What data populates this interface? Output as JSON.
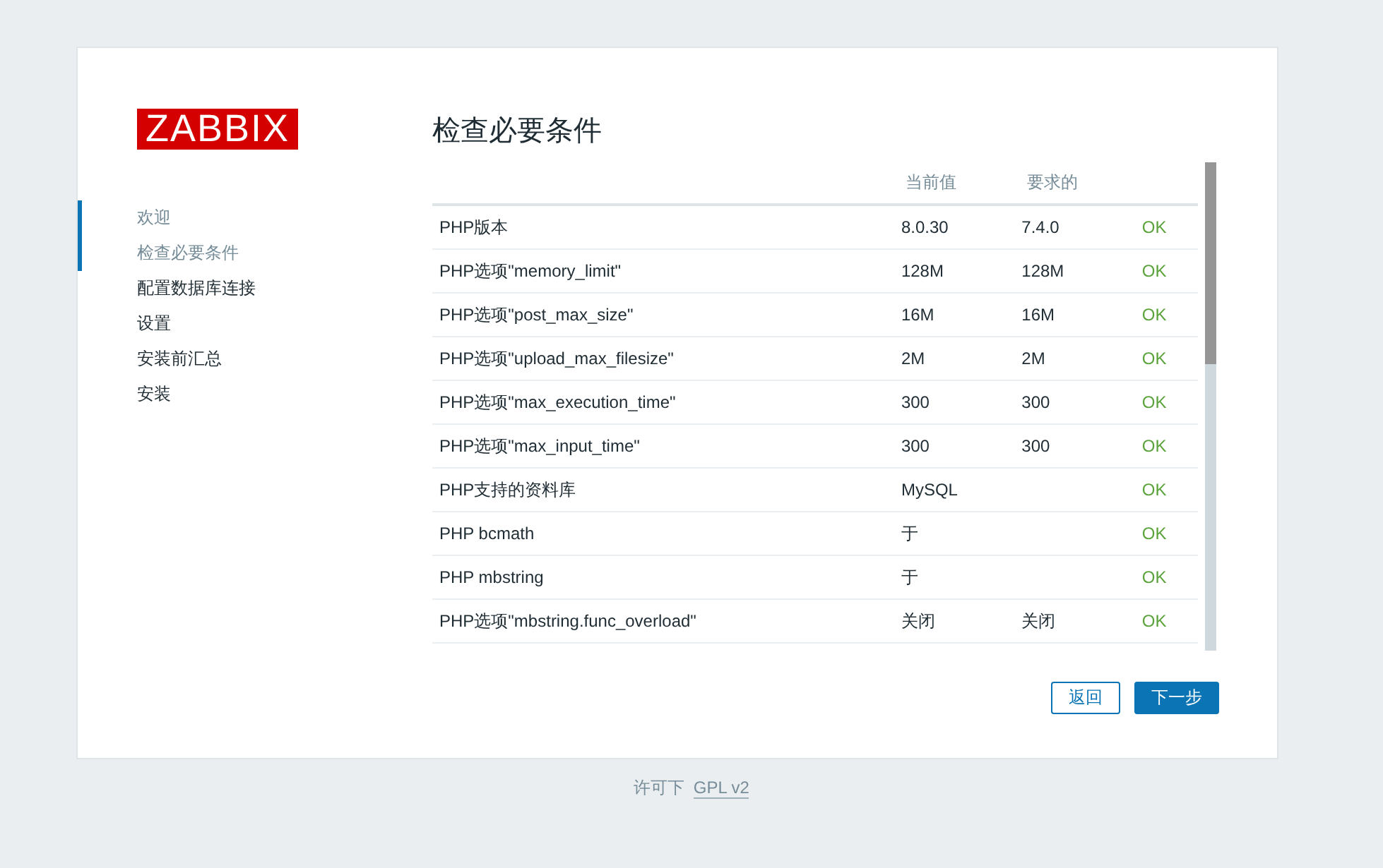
{
  "logo": "ZABBIX",
  "steps": [
    {
      "label": "欢迎",
      "completed": true
    },
    {
      "label": "检查必要条件",
      "completed": true
    },
    {
      "label": "配置数据库连接",
      "completed": false
    },
    {
      "label": "设置",
      "completed": false
    },
    {
      "label": "安装前汇总",
      "completed": false
    },
    {
      "label": "安装",
      "completed": false
    }
  ],
  "title": "检查必要条件",
  "table": {
    "columns": [
      "当前值",
      "要求的"
    ],
    "rows": [
      {
        "name": "PHP版本",
        "current": "8.0.30",
        "required": "7.4.0",
        "status": "OK",
        "kind": "ok"
      },
      {
        "name": "PHP选项\"memory_limit\"",
        "current": "128M",
        "required": "128M",
        "status": "OK",
        "kind": "ok"
      },
      {
        "name": "PHP选项\"post_max_size\"",
        "current": "16M",
        "required": "16M",
        "status": "OK",
        "kind": "ok"
      },
      {
        "name": "PHP选项\"upload_max_filesize\"",
        "current": "2M",
        "required": "2M",
        "status": "OK",
        "kind": "ok"
      },
      {
        "name": "PHP选项\"max_execution_time\"",
        "current": "300",
        "required": "300",
        "status": "OK",
        "kind": "ok"
      },
      {
        "name": "PHP选项\"max_input_time\"",
        "current": "300",
        "required": "300",
        "status": "OK",
        "kind": "ok"
      },
      {
        "name": "PHP支持的资料库",
        "current": "MySQL",
        "required": "",
        "status": "OK",
        "kind": "ok"
      },
      {
        "name": "PHP bcmath",
        "current": "于",
        "required": "",
        "status": "OK",
        "kind": "ok"
      },
      {
        "name": "PHP mbstring",
        "current": "于",
        "required": "",
        "status": "OK",
        "kind": "ok"
      },
      {
        "name": "PHP选项\"mbstring.func_overload\"",
        "current": "关闭",
        "required": "关闭",
        "status": "OK",
        "kind": "ok"
      }
    ]
  },
  "buttons": {
    "back": "返回",
    "next": "下一步"
  },
  "footer": {
    "text": "许可下",
    "link": "GPL v2"
  }
}
